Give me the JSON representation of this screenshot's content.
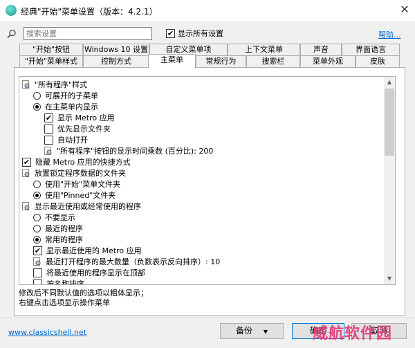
{
  "window": {
    "title": "经典\"开始\"菜单设置（版本：4.2.1）",
    "close_glyph": "✕"
  },
  "toolbar": {
    "search_placeholder": "搜索设置",
    "show_all_label": "显示所有设置",
    "show_all_checked": true,
    "help_label": "帮助..."
  },
  "tabs_row1": [
    "\"开始\"按钮",
    "Windows 10 设置",
    "自定义菜单项",
    "上下文菜单",
    "声音",
    "界面语言"
  ],
  "tabs_row2": [
    "\"开始\"菜单样式",
    "控制方式",
    "主菜单",
    "常规行为",
    "搜索栏",
    "菜单外观",
    "皮肤"
  ],
  "active_tab": "主菜单",
  "tree": [
    {
      "type": "group",
      "label": "\"所有程序\"样式"
    },
    {
      "type": "radio",
      "checked": false,
      "label": "可展开的子菜单"
    },
    {
      "type": "radio",
      "checked": true,
      "label": "在主菜单内显示"
    },
    {
      "type": "check",
      "checked": true,
      "label": "显示 Metro 应用"
    },
    {
      "type": "check",
      "checked": false,
      "label": "优先显示文件夹"
    },
    {
      "type": "check",
      "checked": false,
      "label": "自动打开"
    },
    {
      "type": "setting",
      "label": "\"所有程序\"按钮的显示时间乘数 (百分比): 200"
    },
    {
      "type": "check",
      "checked": true,
      "label": "隐藏 Metro 应用的快捷方式"
    },
    {
      "type": "group",
      "label": "放置锁定程序数据的文件夹"
    },
    {
      "type": "radio",
      "checked": false,
      "label": "使用\"开始\"菜单文件夹"
    },
    {
      "type": "radio",
      "checked": true,
      "label": "使用\"Pinned\"文件夹"
    },
    {
      "type": "group",
      "label": "显示最近使用或经常使用的程序"
    },
    {
      "type": "radio",
      "checked": false,
      "label": "不要显示"
    },
    {
      "type": "radio",
      "checked": false,
      "label": "最近的程序"
    },
    {
      "type": "radio",
      "checked": true,
      "label": "常用的程序"
    },
    {
      "type": "check",
      "checked": true,
      "label": "显示最近使用的 Metro 应用"
    },
    {
      "type": "setting",
      "label": "最近打开程序的最大数量（负数表示反向排序）: 10"
    },
    {
      "type": "check",
      "checked": false,
      "label": "将最近使用的程序显示在顶部"
    },
    {
      "type": "check",
      "checked": false,
      "label": "按名称排序"
    }
  ],
  "hint_lines": [
    "修改后不同默认值的选项以粗体显示；",
    "右键点击选项显示操作菜单"
  ],
  "footer": {
    "site_link": "www.classicshell.net",
    "backup_label": "备份",
    "ok_label": "确定",
    "cancel_label": "取消",
    "watermark": "威航软件园"
  },
  "colors": {
    "accent": "#0078d7",
    "link": "#0066cc",
    "watermark": "#e23a7b"
  }
}
